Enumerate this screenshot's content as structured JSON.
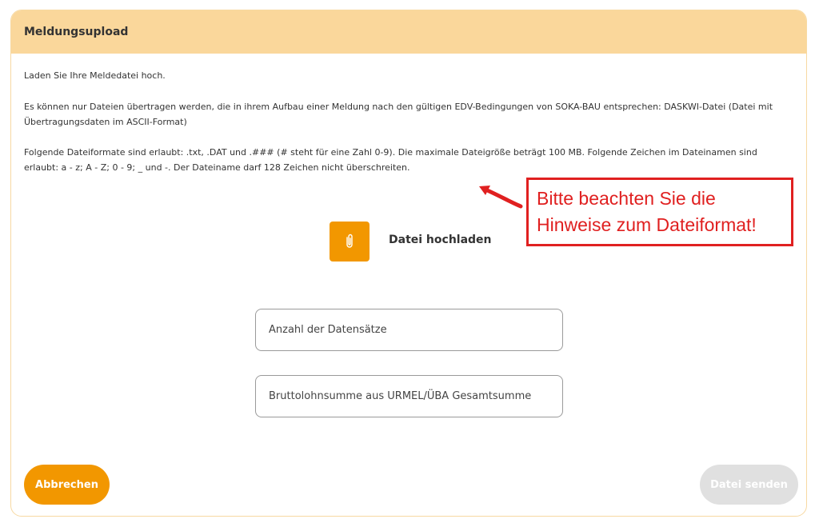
{
  "panel": {
    "title": "Meldungsupload"
  },
  "info": {
    "line1": "Laden Sie Ihre Meldedatei hoch.",
    "line2": "Es können nur Dateien übertragen werden, die in ihrem Aufbau einer Meldung nach den gültigen EDV-Bedingungen von SOKA-BAU entsprechen: DASKWI-Datei (Datei mit Übertragungsdaten im ASCII-Format)",
    "line3": "Folgende Dateiformate sind erlaubt: .txt, .DAT und .### (# steht für eine Zahl 0-9). Die maximale Dateigröße beträgt 100 MB. Folgende Zeichen im Dateinamen sind erlaubt: a - z; A - Z; 0 - 9; _ und -. Der Dateiname darf 128 Zeichen nicht überschreiten."
  },
  "upload": {
    "icon": "paperclip-icon",
    "label": "Datei hochladen"
  },
  "fields": {
    "records_placeholder": "Anzahl der Datensätze",
    "gross_placeholder": "Bruttolohnsumme aus URMEL/ÜBA Gesamtsumme"
  },
  "actions": {
    "cancel_label": "Abbrechen",
    "send_label": "Datei senden",
    "send_disabled": true
  },
  "annotation": {
    "text_line1": "Bitte beachten Sie die",
    "text_line2": "Hinweise zum Dateiformat!",
    "color": "#e02020"
  },
  "colors": {
    "accent": "#f29700",
    "header_bg": "#fad79b",
    "disabled": "#e0e0e0"
  }
}
